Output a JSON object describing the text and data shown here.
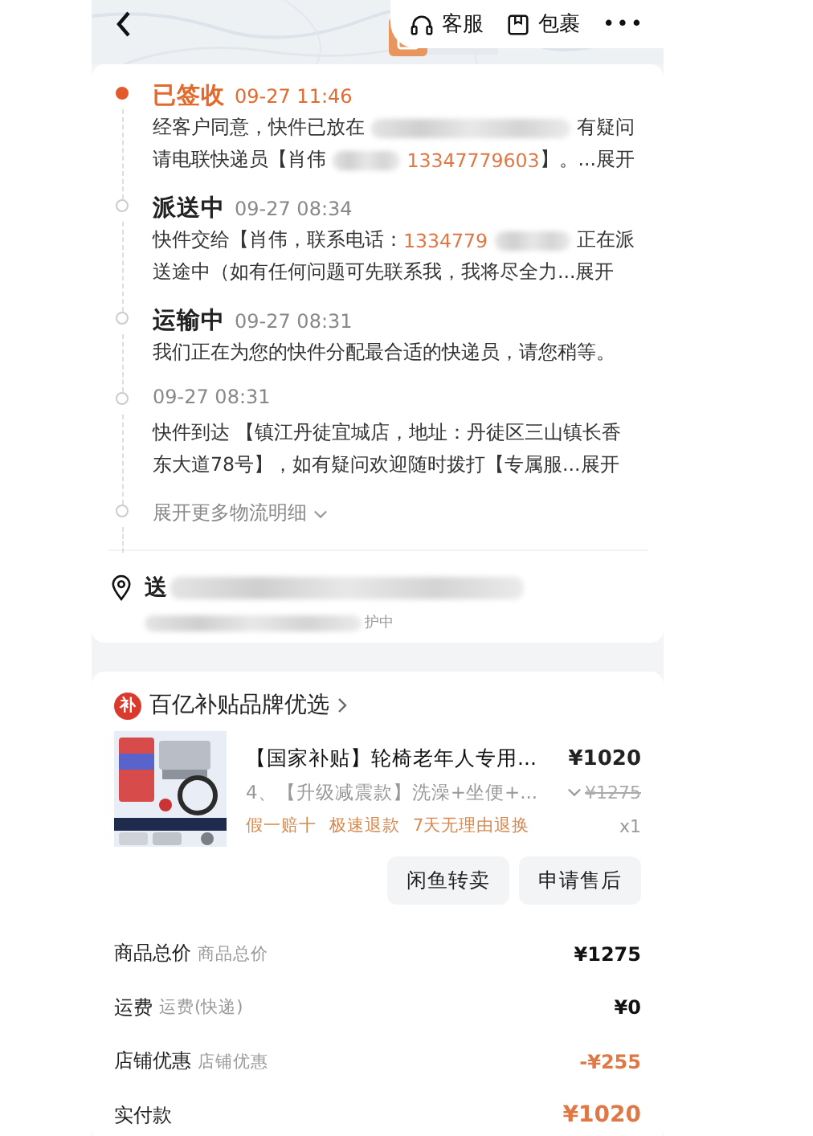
{
  "top_bar": {
    "actions": [
      {
        "kind": "headset",
        "label": "客服"
      },
      {
        "kind": "package",
        "label": "包裹"
      }
    ],
    "more": "•••"
  },
  "timeline": {
    "events": [
      {
        "status": "已签收",
        "time": "09-27 11:46",
        "current": true,
        "lines": [
          [
            {
              "kind": "text",
              "text": "经客户同意，快件已放在"
            },
            {
              "kind": "blur"
            },
            {
              "kind": "text",
              "text": "有疑问"
            }
          ],
          [
            {
              "kind": "text",
              "text": "请电联快递员【肖伟"
            },
            {
              "kind": "blur"
            },
            {
              "kind": "phone",
              "text": "13347779603"
            },
            {
              "kind": "text",
              "text": "】。...展开"
            }
          ]
        ]
      },
      {
        "status": "派送中",
        "time": "09-27 08:34",
        "current": false,
        "lines": [
          [
            {
              "kind": "text",
              "text": "快件交给【肖伟，联系电话："
            },
            {
              "kind": "phone",
              "text": "1334779"
            },
            {
              "kind": "blur"
            },
            {
              "kind": "text",
              "text": "正在派"
            }
          ],
          [
            {
              "kind": "text",
              "text": "送途中（如有任何问题可先联系我，我将尽全力...展开"
            }
          ]
        ]
      },
      {
        "status": "运输中",
        "time": "09-27 08:31",
        "current": false,
        "lines": [
          [
            {
              "kind": "text",
              "text": "我们正在为您的快件分配最合适的快递员，请您稍等。"
            }
          ]
        ]
      },
      {
        "time": "09-27 08:31",
        "current": false,
        "lines": [
          [
            {
              "kind": "text",
              "text": "快件到达 【镇江丹徒宜城店，地址：丹徒区三山镇长香"
            }
          ],
          [
            {
              "kind": "text",
              "text": "东大道78号】，如有疑问欢迎随时拨打【专属服...展开"
            }
          ]
        ]
      }
    ],
    "expand": "展开更多物流明细"
  },
  "address": {
    "label": "送",
    "note": "护中"
  },
  "shop": {
    "badge": "补",
    "name": "百亿补贴品牌优选"
  },
  "product": {
    "title": "【国家补贴】轮椅老年人专用...",
    "price": "¥1020",
    "variant": "4、【升级减震款】洗澡+坐便+...",
    "original_price": "¥1275",
    "tags": [
      "假一赔十",
      "极速退款",
      "7天无理由退换"
    ],
    "quantity": "x1"
  },
  "buttons": [
    "闲鱼转卖",
    "申请售后"
  ],
  "fees": [
    {
      "label": "商品总价",
      "sub": "商品总价",
      "value": "¥1275",
      "kind": "normal"
    },
    {
      "label": "运费",
      "sub": "运费(快递)",
      "value": "¥0",
      "kind": "normal"
    },
    {
      "label": "店铺优惠",
      "sub": "店铺优惠",
      "value": "-¥255",
      "kind": "discount"
    },
    {
      "label": "实付款",
      "value": "¥1020",
      "kind": "total"
    }
  ]
}
